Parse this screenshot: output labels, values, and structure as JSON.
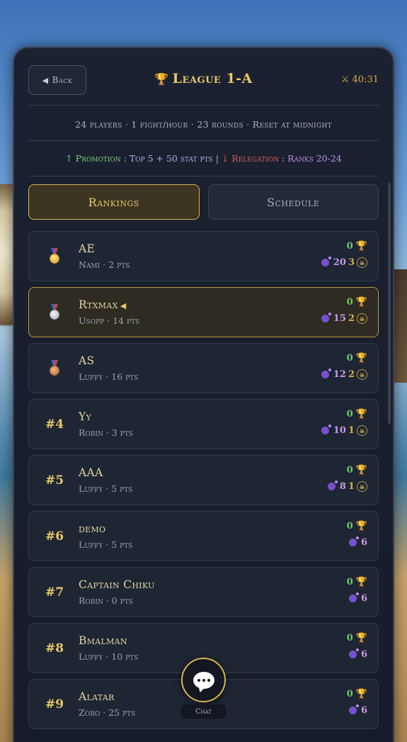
{
  "header": {
    "back_label": "Back",
    "title": "League 1-A",
    "timer": "40:31"
  },
  "info": {
    "summary": "24 players · 1 fight/hour · 23 rounds · Reset at midnight",
    "promotion_label": "↑ Promotion",
    "promotion_value": "Top 5 + 50 stat pts",
    "separator": "|",
    "relegation_label": "↓ Relegation",
    "relegation_value": "Ranks 20-24"
  },
  "tabs": [
    {
      "label": "Rankings",
      "active": true
    },
    {
      "label": "Schedule",
      "active": false
    }
  ],
  "rankings": [
    {
      "rank": "",
      "medal": "gold",
      "name": "AE",
      "sub": "Nami · 2 pts",
      "wins": "0",
      "stat": "20",
      "gold": "3",
      "me": false
    },
    {
      "rank": "",
      "medal": "silver",
      "name": "Rtxmax",
      "sub": "Usopp · 14 pts",
      "wins": "0",
      "stat": "15",
      "gold": "2",
      "me": true
    },
    {
      "rank": "",
      "medal": "bronze",
      "name": "AS",
      "sub": "Luffy · 16 pts",
      "wins": "0",
      "stat": "12",
      "gold": "2",
      "me": false
    },
    {
      "rank": "#4",
      "medal": "",
      "name": "Yy",
      "sub": "Robin · 3 pts",
      "wins": "0",
      "stat": "10",
      "gold": "1",
      "me": false
    },
    {
      "rank": "#5",
      "medal": "",
      "name": "AAA",
      "sub": "Luffy · 5 pts",
      "wins": "0",
      "stat": "8",
      "gold": "1",
      "me": false
    },
    {
      "rank": "#6",
      "medal": "",
      "name": "demo",
      "sub": "Luffy · 5 pts",
      "wins": "0",
      "stat": "6",
      "gold": "",
      "me": false
    },
    {
      "rank": "#7",
      "medal": "",
      "name": "Captain Chiku",
      "sub": "Robin · 0 pts",
      "wins": "0",
      "stat": "6",
      "gold": "",
      "me": false
    },
    {
      "rank": "#8",
      "medal": "",
      "name": "Bmalman",
      "sub": "Luffy · 10 pts",
      "wins": "0",
      "stat": "6",
      "gold": "",
      "me": false
    },
    {
      "rank": "#9",
      "medal": "",
      "name": "Alatar",
      "sub": "Zoro · 25 pts",
      "wins": "0",
      "stat": "6",
      "gold": "",
      "me": false
    }
  ],
  "chat": {
    "label": "Chat"
  },
  "colors": {
    "accent_gold": "#e8c765",
    "promotion": "#7bcf7b",
    "relegation": "#d65f5f",
    "panel_bg": "#1b2130"
  }
}
